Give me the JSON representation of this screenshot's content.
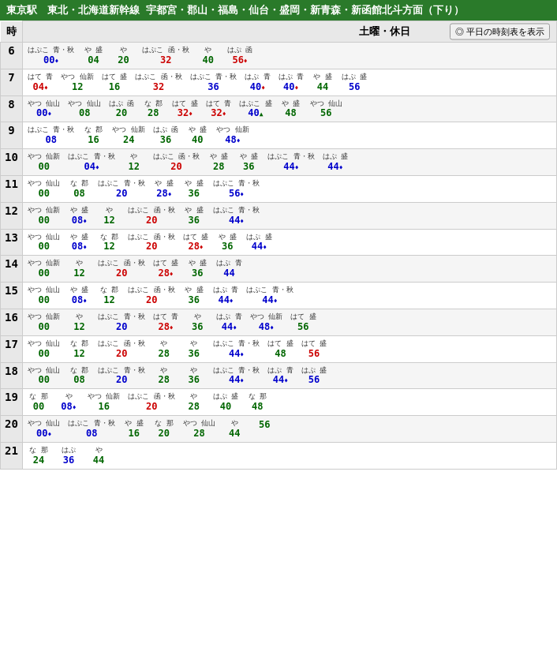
{
  "header": {
    "title": "東京駅　東北・北海道新幹線 宇都宮・郡山・福島・仙台・盛岡・新青森・新函館北斗方面（下り）"
  },
  "subheader": {
    "day_label": "土曜・休日",
    "toggle_label": "平日の時刻表を表示"
  },
  "hours_label": "時",
  "rows": [
    {
      "hour": "6",
      "trains": [
        {
          "name": "はぷこ 青・秋",
          "time": "00",
          "color": "blue",
          "mark": "diamond-blue"
        },
        {
          "name": "や 盛",
          "time": "04",
          "color": "green",
          "mark": ""
        },
        {
          "name": "や",
          "time": "20",
          "color": "green",
          "mark": ""
        },
        {
          "name": "はぷこ 函・秋",
          "time": "32",
          "color": "red",
          "mark": ""
        },
        {
          "name": "や",
          "time": "40",
          "color": "green",
          "mark": ""
        },
        {
          "name": "はぷ 函",
          "time": "56",
          "color": "red",
          "mark": "diamond"
        }
      ]
    },
    {
      "hour": "7",
      "trains": [
        {
          "name": "はて 青",
          "time": "04",
          "color": "red",
          "mark": "diamond"
        },
        {
          "name": "やつ 仙新",
          "time": "12",
          "color": "green",
          "mark": ""
        },
        {
          "name": "はて 盛",
          "time": "16",
          "color": "green",
          "mark": ""
        },
        {
          "name": "はぷこ 函・秋",
          "time": "32",
          "color": "red",
          "mark": ""
        },
        {
          "name": "はぷこ 青・秋",
          "time": "36",
          "color": "blue",
          "mark": ""
        },
        {
          "name": "はぷ 青",
          "time": "40",
          "color": "blue",
          "mark": "diamond"
        },
        {
          "name": "はぷ 青",
          "time": "40",
          "color": "blue",
          "mark": "diamond"
        },
        {
          "name": "や 盛",
          "time": "44",
          "color": "green",
          "mark": ""
        },
        {
          "name": "はぷ 盛",
          "time": "56",
          "color": "blue",
          "mark": ""
        }
      ]
    },
    {
      "hour": "8",
      "trains": [
        {
          "name": "やつ 仙山",
          "time": "00",
          "color": "blue",
          "mark": "diamond-blue"
        },
        {
          "name": "やつ 仙山",
          "time": "08",
          "color": "green",
          "mark": ""
        },
        {
          "name": "はぷ 函",
          "time": "20",
          "color": "green",
          "mark": ""
        },
        {
          "name": "な 郡",
          "time": "28",
          "color": "green",
          "mark": ""
        },
        {
          "name": "はて 盛",
          "time": "32",
          "color": "red",
          "mark": "diamond"
        },
        {
          "name": "はて 青",
          "time": "32",
          "color": "red",
          "mark": "diamond"
        },
        {
          "name": "はぷこ 盛",
          "time": "40",
          "color": "blue",
          "mark": "triangle"
        },
        {
          "name": "や 盛",
          "time": "48",
          "color": "green",
          "mark": ""
        },
        {
          "name": "やつ 仙山",
          "time": "56",
          "color": "green",
          "mark": ""
        }
      ]
    },
    {
      "hour": "9",
      "trains": [
        {
          "name": "はぷこ 青・秋",
          "time": "08",
          "color": "blue",
          "mark": ""
        },
        {
          "name": "な 郡",
          "time": "16",
          "color": "green",
          "mark": ""
        },
        {
          "name": "やつ 仙新",
          "time": "24",
          "color": "green",
          "mark": ""
        },
        {
          "name": "はぷ 函",
          "time": "36",
          "color": "green",
          "mark": ""
        },
        {
          "name": "や 盛",
          "time": "40",
          "color": "green",
          "mark": ""
        },
        {
          "name": "やつ 仙新",
          "time": "48",
          "color": "blue",
          "mark": "diamond-blue"
        }
      ]
    },
    {
      "hour": "10",
      "trains": [
        {
          "name": "やつ 仙新",
          "time": "00",
          "color": "green",
          "mark": ""
        },
        {
          "name": "はぷこ 青・秋",
          "time": "04",
          "color": "blue",
          "mark": "diamond-blue"
        },
        {
          "name": "や",
          "time": "12",
          "color": "green",
          "mark": ""
        },
        {
          "name": "はぷこ 函・秋",
          "time": "20",
          "color": "red",
          "mark": ""
        },
        {
          "name": "や 盛",
          "time": "28",
          "color": "green",
          "mark": ""
        },
        {
          "name": "や 盛",
          "time": "36",
          "color": "green",
          "mark": ""
        },
        {
          "name": "はぷこ 青・秋",
          "time": "44",
          "color": "blue",
          "mark": "diamond-blue"
        },
        {
          "name": "はぷ 盛",
          "time": "44",
          "color": "blue",
          "mark": "diamond-blue"
        }
      ]
    },
    {
      "hour": "11",
      "trains": [
        {
          "name": "やつ 仙山",
          "time": "00",
          "color": "green",
          "mark": ""
        },
        {
          "name": "な 郡",
          "time": "08",
          "color": "green",
          "mark": ""
        },
        {
          "name": "はぷこ 青・秋",
          "time": "20",
          "color": "blue",
          "mark": ""
        },
        {
          "name": "や 盛",
          "time": "28",
          "color": "blue",
          "mark": "diamond-blue"
        },
        {
          "name": "や 盛",
          "time": "36",
          "color": "green",
          "mark": ""
        },
        {
          "name": "はぷこ 青・秋",
          "time": "56",
          "color": "blue",
          "mark": "diamond-blue"
        }
      ]
    },
    {
      "hour": "12",
      "trains": [
        {
          "name": "やつ 仙新",
          "time": "00",
          "color": "green",
          "mark": ""
        },
        {
          "name": "や 盛",
          "time": "08",
          "color": "blue",
          "mark": "diamond-blue"
        },
        {
          "name": "や",
          "time": "12",
          "color": "green",
          "mark": ""
        },
        {
          "name": "はぷこ 函・秋",
          "time": "20",
          "color": "red",
          "mark": ""
        },
        {
          "name": "や 盛",
          "time": "36",
          "color": "green",
          "mark": ""
        },
        {
          "name": "はぷこ 青・秋",
          "time": "44",
          "color": "blue",
          "mark": "diamond-blue"
        }
      ]
    },
    {
      "hour": "13",
      "trains": [
        {
          "name": "やつ 仙山",
          "time": "00",
          "color": "green",
          "mark": ""
        },
        {
          "name": "や 盛",
          "time": "08",
          "color": "blue",
          "mark": "diamond-blue"
        },
        {
          "name": "な 郡",
          "time": "12",
          "color": "green",
          "mark": ""
        },
        {
          "name": "はぷこ 函・秋",
          "time": "20",
          "color": "red",
          "mark": ""
        },
        {
          "name": "はて 盛",
          "time": "28",
          "color": "red",
          "mark": "diamond"
        },
        {
          "name": "や 盛",
          "time": "36",
          "color": "green",
          "mark": ""
        },
        {
          "name": "はぷ 盛",
          "time": "44",
          "color": "blue",
          "mark": "diamond-blue"
        }
      ]
    },
    {
      "hour": "14",
      "trains": [
        {
          "name": "やつ 仙新",
          "time": "00",
          "color": "green",
          "mark": ""
        },
        {
          "name": "や",
          "time": "12",
          "color": "green",
          "mark": ""
        },
        {
          "name": "はぷこ 函・秋",
          "time": "20",
          "color": "red",
          "mark": ""
        },
        {
          "name": "はて 盛",
          "time": "28",
          "color": "red",
          "mark": "diamond"
        },
        {
          "name": "や 盛",
          "time": "36",
          "color": "green",
          "mark": ""
        },
        {
          "name": "はぷ 青",
          "time": "44",
          "color": "blue",
          "mark": ""
        }
      ]
    },
    {
      "hour": "15",
      "trains": [
        {
          "name": "やつ 仙山",
          "time": "00",
          "color": "green",
          "mark": ""
        },
        {
          "name": "や 盛",
          "time": "08",
          "color": "blue",
          "mark": "diamond-blue"
        },
        {
          "name": "な 郡",
          "time": "12",
          "color": "green",
          "mark": ""
        },
        {
          "name": "はぷこ 函・秋",
          "time": "20",
          "color": "red",
          "mark": ""
        },
        {
          "name": "や 盛",
          "time": "36",
          "color": "green",
          "mark": ""
        },
        {
          "name": "はぷ 青",
          "time": "44",
          "color": "blue",
          "mark": "diamond-blue"
        },
        {
          "name": "はぷこ 青・秋",
          "time": "44",
          "color": "blue",
          "mark": "diamond-blue"
        }
      ]
    },
    {
      "hour": "16",
      "trains": [
        {
          "name": "やつ 仙新",
          "time": "00",
          "color": "green",
          "mark": ""
        },
        {
          "name": "や",
          "time": "12",
          "color": "green",
          "mark": ""
        },
        {
          "name": "はぷこ 青・秋",
          "time": "20",
          "color": "blue",
          "mark": ""
        },
        {
          "name": "はて 青",
          "time": "28",
          "color": "red",
          "mark": "diamond"
        },
        {
          "name": "や",
          "time": "36",
          "color": "green",
          "mark": ""
        },
        {
          "name": "はぷ 青",
          "time": "44",
          "color": "blue",
          "mark": "diamond-blue"
        },
        {
          "name": "やつ 仙新",
          "time": "48",
          "color": "blue",
          "mark": "diamond-blue"
        },
        {
          "name": "はて 盛",
          "time": "56",
          "color": "green",
          "mark": ""
        }
      ]
    },
    {
      "hour": "17",
      "trains": [
        {
          "name": "やつ 仙山",
          "time": "00",
          "color": "green",
          "mark": ""
        },
        {
          "name": "な 郡",
          "time": "12",
          "color": "green",
          "mark": ""
        },
        {
          "name": "はぷこ 函・秋",
          "time": "20",
          "color": "red",
          "mark": ""
        },
        {
          "name": "や",
          "time": "28",
          "color": "green",
          "mark": ""
        },
        {
          "name": "や",
          "time": "36",
          "color": "green",
          "mark": ""
        },
        {
          "name": "はぷこ 青・秋",
          "time": "44",
          "color": "blue",
          "mark": "diamond-blue"
        },
        {
          "name": "はて 盛",
          "time": "48",
          "color": "green",
          "mark": ""
        },
        {
          "name": "はて 盛",
          "time": "56",
          "color": "red",
          "mark": ""
        }
      ]
    },
    {
      "hour": "18",
      "trains": [
        {
          "name": "やつ 仙山",
          "time": "00",
          "color": "green",
          "mark": ""
        },
        {
          "name": "な 郡",
          "time": "08",
          "color": "green",
          "mark": ""
        },
        {
          "name": "はぷこ 青・秋",
          "time": "20",
          "color": "blue",
          "mark": ""
        },
        {
          "name": "や",
          "time": "28",
          "color": "green",
          "mark": ""
        },
        {
          "name": "や",
          "time": "36",
          "color": "green",
          "mark": ""
        },
        {
          "name": "はぷこ 青・秋",
          "time": "44",
          "color": "blue",
          "mark": "diamond-blue"
        },
        {
          "name": "はぷ 青",
          "time": "44",
          "color": "blue",
          "mark": "diamond-blue"
        },
        {
          "name": "はぷ 盛",
          "time": "56",
          "color": "blue",
          "mark": ""
        }
      ]
    },
    {
      "hour": "19",
      "trains": [
        {
          "name": "な 那",
          "time": "00",
          "color": "green",
          "mark": ""
        },
        {
          "name": "や",
          "time": "08",
          "color": "blue",
          "mark": "diamond-blue"
        },
        {
          "name": "やつ 仙新",
          "time": "16",
          "color": "green",
          "mark": ""
        },
        {
          "name": "はぷこ 函・秋",
          "time": "20",
          "color": "red",
          "mark": ""
        },
        {
          "name": "や",
          "time": "28",
          "color": "green",
          "mark": ""
        },
        {
          "name": "はぷ 盛",
          "time": "40",
          "color": "green",
          "mark": ""
        },
        {
          "name": "な 那",
          "time": "48",
          "color": "green",
          "mark": ""
        }
      ]
    },
    {
      "hour": "20",
      "trains": [
        {
          "name": "やつ 仙山",
          "time": "00",
          "color": "blue",
          "mark": "diamond-blue"
        },
        {
          "name": "はぷこ 青・秋",
          "time": "08",
          "color": "blue",
          "mark": ""
        },
        {
          "name": "や 盛",
          "time": "16",
          "color": "green",
          "mark": ""
        },
        {
          "name": "な 那",
          "time": "20",
          "color": "green",
          "mark": ""
        },
        {
          "name": "やつ 仙山",
          "time": "28",
          "color": "green",
          "mark": ""
        },
        {
          "name": "や",
          "time": "44",
          "color": "green",
          "mark": ""
        },
        {
          "name": "",
          "time": "56",
          "color": "green",
          "mark": ""
        }
      ]
    },
    {
      "hour": "21",
      "trains": [
        {
          "name": "な 那",
          "time": "24",
          "color": "green",
          "mark": ""
        },
        {
          "name": "はぷ",
          "time": "36",
          "color": "blue",
          "mark": ""
        },
        {
          "name": "や",
          "time": "44",
          "color": "green",
          "mark": ""
        }
      ]
    }
  ]
}
